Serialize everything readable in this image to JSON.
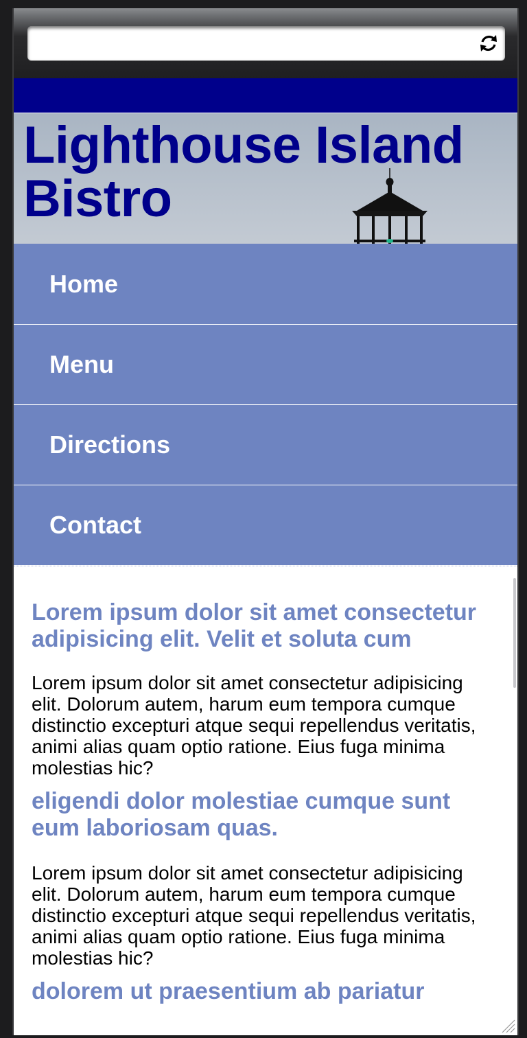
{
  "site": {
    "title": "Lighthouse Island Bistro"
  },
  "nav": {
    "items": [
      {
        "label": "Home"
      },
      {
        "label": "Menu"
      },
      {
        "label": "Directions"
      },
      {
        "label": "Contact"
      }
    ]
  },
  "content": {
    "sections": [
      {
        "heading": "Lorem ipsum dolor sit amet consectetur adipisicing elit. Velit et soluta cum",
        "body": "Lorem ipsum dolor sit amet consectetur adipisicing elit. Dolorum autem, harum eum tempora cumque distinctio excepturi atque sequi repellendus veritatis, animi alias quam optio ratione. Eius fuga minima molestias hic?"
      },
      {
        "heading": "eligendi dolor molestiae cumque sunt eum laboriosam quas.",
        "body": "Lorem ipsum dolor sit amet consectetur adipisicing elit. Dolorum autem, harum eum tempora cumque distinctio excepturi atque sequi repellendus veritatis, animi alias quam optio ratione. Eius fuga minima molestias hic?"
      },
      {
        "heading": "dolorem ut praesentium ab pariatur"
      }
    ]
  },
  "colors": {
    "brand_blue": "#00008b",
    "nav_bg": "#6e84c1",
    "heading": "#6e84c1"
  },
  "icons": {
    "reload": "reload-icon"
  }
}
